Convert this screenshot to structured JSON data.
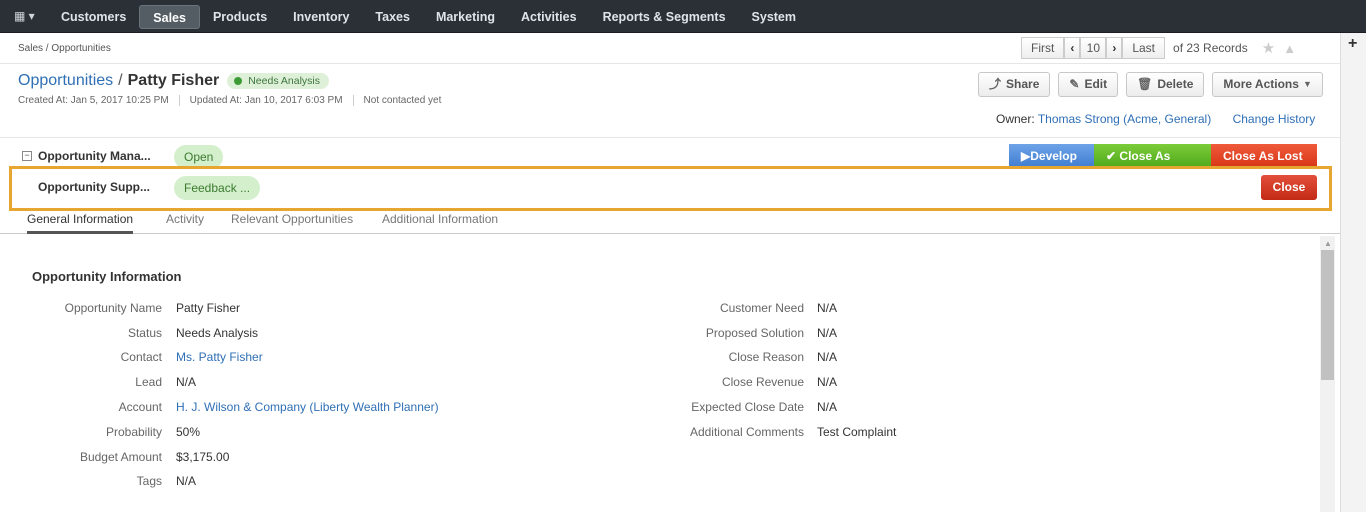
{
  "nav": {
    "items": [
      "Customers",
      "Sales",
      "Products",
      "Inventory",
      "Taxes",
      "Marketing",
      "Activities",
      "Reports & Segments",
      "System"
    ],
    "active": "Sales"
  },
  "breadcrumb": "Sales / Opportunities",
  "pager": {
    "first": "First",
    "page": "10",
    "last": "Last",
    "records": "of 23 Records"
  },
  "header": {
    "entity": "Opportunities",
    "name": "Patty Fisher",
    "status": "Needs Analysis",
    "created": "Created At: Jan 5, 2017 10:25 PM",
    "updated": "Updated At: Jan 10, 2017 6:03 PM",
    "contacted": "Not contacted yet"
  },
  "actions": {
    "share": "Share",
    "edit": "Edit",
    "delete": "Delete",
    "more": "More Actions"
  },
  "owner": {
    "label": "Owner:",
    "name": "Thomas Strong (Acme, General)",
    "change_history": "Change History"
  },
  "processes": [
    {
      "name": "Opportunity Mana...",
      "state": "Open"
    },
    {
      "name": "Opportunity Supp...",
      "state": "Feedback ..."
    }
  ],
  "stages": {
    "develop": "Develop",
    "won": "Close As Won",
    "lost": "Close As Lost",
    "close": "Close"
  },
  "tabs": [
    "General Information",
    "Activity",
    "Relevant Opportunities",
    "Additional Information"
  ],
  "section_title": "Opportunity Information",
  "left_fields": [
    {
      "label": "Opportunity Name",
      "value": "Patty Fisher"
    },
    {
      "label": "Status",
      "value": "Needs Analysis"
    },
    {
      "label": "Contact",
      "value": "Ms. Patty Fisher"
    },
    {
      "label": "Lead",
      "value": "N/A"
    },
    {
      "label": "Account",
      "value": "H. J. Wilson & Company",
      "value2": "(Liberty Wealth Planner)"
    },
    {
      "label": "Probability",
      "value": "50%"
    },
    {
      "label": "Budget Amount",
      "value": "$3,175.00"
    },
    {
      "label": "Tags",
      "value": "N/A"
    }
  ],
  "right_fields": [
    {
      "label": "Customer Need",
      "value": "N/A"
    },
    {
      "label": "Proposed Solution",
      "value": "N/A"
    },
    {
      "label": "Close Reason",
      "value": "N/A"
    },
    {
      "label": "Close Revenue",
      "value": "N/A"
    },
    {
      "label": "Expected Close Date",
      "value": "N/A"
    },
    {
      "label": "Additional Comments",
      "value": "Test Complaint"
    }
  ]
}
